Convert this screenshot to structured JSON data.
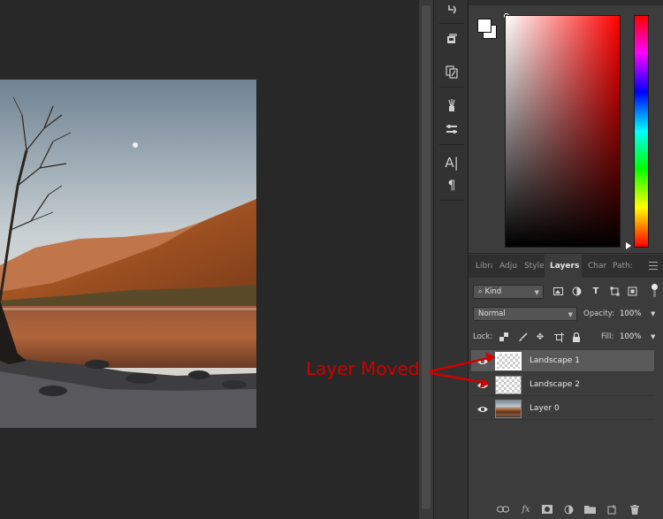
{
  "colors": {
    "annotation": "#d20000",
    "foreground_swatch": "#ffffff",
    "background_swatch": "#ffffff",
    "selected_layer_bg": "#595959"
  },
  "toolbar_icons": [
    "history-icon",
    "3d-materials-icon",
    "clone-source-icon",
    "brushes-icon",
    "brush-settings-icon",
    "character-icon",
    "paragraph-icon"
  ],
  "layers_panel": {
    "tabs": [
      {
        "label": "Libra",
        "active": false
      },
      {
        "label": "Adju",
        "active": false
      },
      {
        "label": "Style",
        "active": false
      },
      {
        "label": "Layers",
        "active": true
      },
      {
        "label": "Char",
        "active": false
      },
      {
        "label": "Path:",
        "active": false
      }
    ],
    "filter": {
      "label": "Kind"
    },
    "blend_mode": "Normal",
    "opacity_label": "Opacity:",
    "opacity_value": "100%",
    "lock_label": "Lock:",
    "fill_label": "Fill:",
    "fill_value": "100%",
    "layers": [
      {
        "name": "Landscape 1",
        "selected": true,
        "visible": true,
        "thumb": "transparent"
      },
      {
        "name": "Landscape 2",
        "selected": false,
        "visible": true,
        "thumb": "transparent"
      },
      {
        "name": "Layer 0",
        "selected": false,
        "visible": true,
        "thumb": "photo"
      }
    ]
  },
  "annotation": {
    "text": "Layer Moved"
  }
}
